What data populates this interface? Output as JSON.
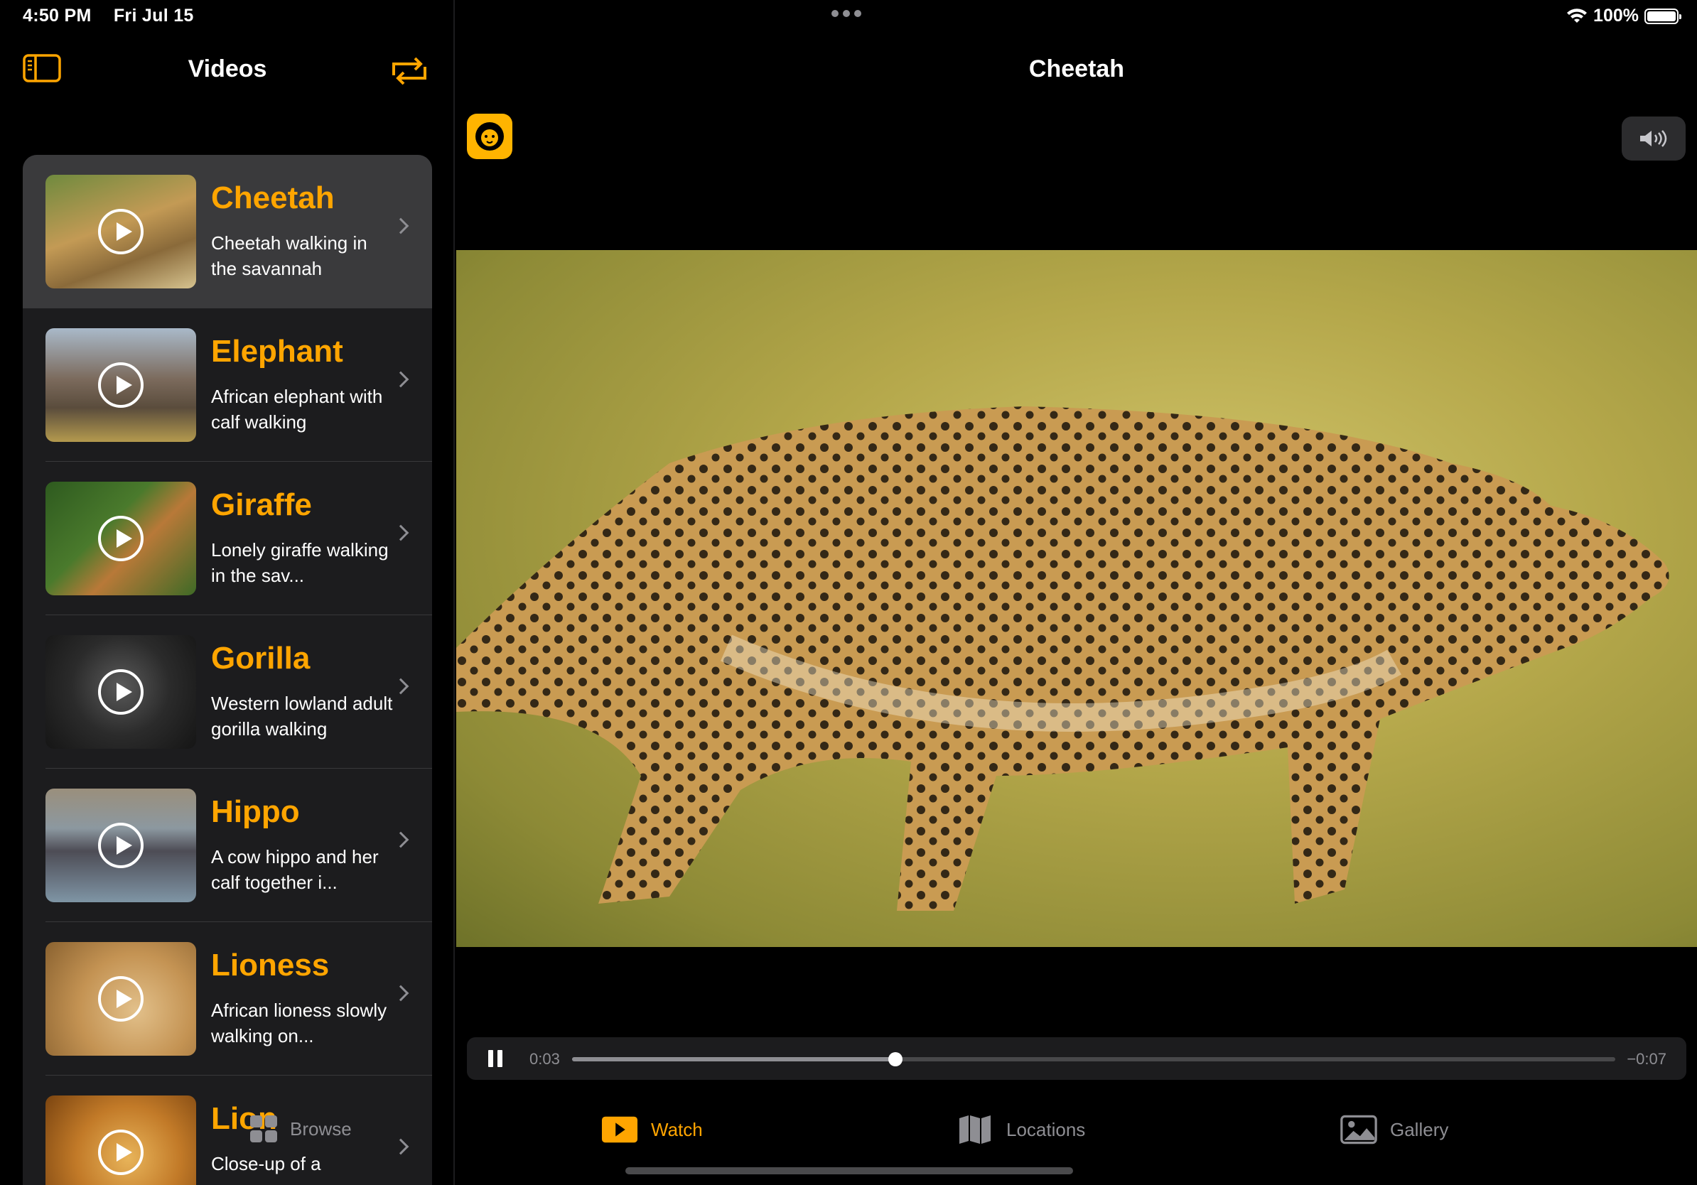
{
  "status": {
    "time": "4:50 PM",
    "date": "Fri Jul 15",
    "battery": "100%"
  },
  "sidebar": {
    "title": "Videos",
    "items": [
      {
        "title": "Cheetah",
        "subtitle": "Cheetah walking in the savannah",
        "selected": true
      },
      {
        "title": "Elephant",
        "subtitle": "African elephant with calf walking",
        "selected": false
      },
      {
        "title": "Giraffe",
        "subtitle": "Lonely giraffe walking in the sav...",
        "selected": false
      },
      {
        "title": "Gorilla",
        "subtitle": "Western lowland adult gorilla walking",
        "selected": false
      },
      {
        "title": "Hippo",
        "subtitle": "A cow hippo and her calf together i...",
        "selected": false
      },
      {
        "title": "Lioness",
        "subtitle": "African lioness slowly walking on...",
        "selected": false
      },
      {
        "title": "Lion",
        "subtitle": "Close-up of a",
        "selected": false
      }
    ]
  },
  "main": {
    "title": "Cheetah"
  },
  "player": {
    "current_time": "0:03",
    "remaining_time": "−0:07",
    "progress": 0.31
  },
  "tabs": {
    "browse": "Browse",
    "watch": "Watch",
    "locations": "Locations",
    "gallery": "Gallery"
  },
  "colors": {
    "accent": "#ffa500",
    "panel": "#1c1c1e",
    "selected_row": "#3a3a3c"
  }
}
